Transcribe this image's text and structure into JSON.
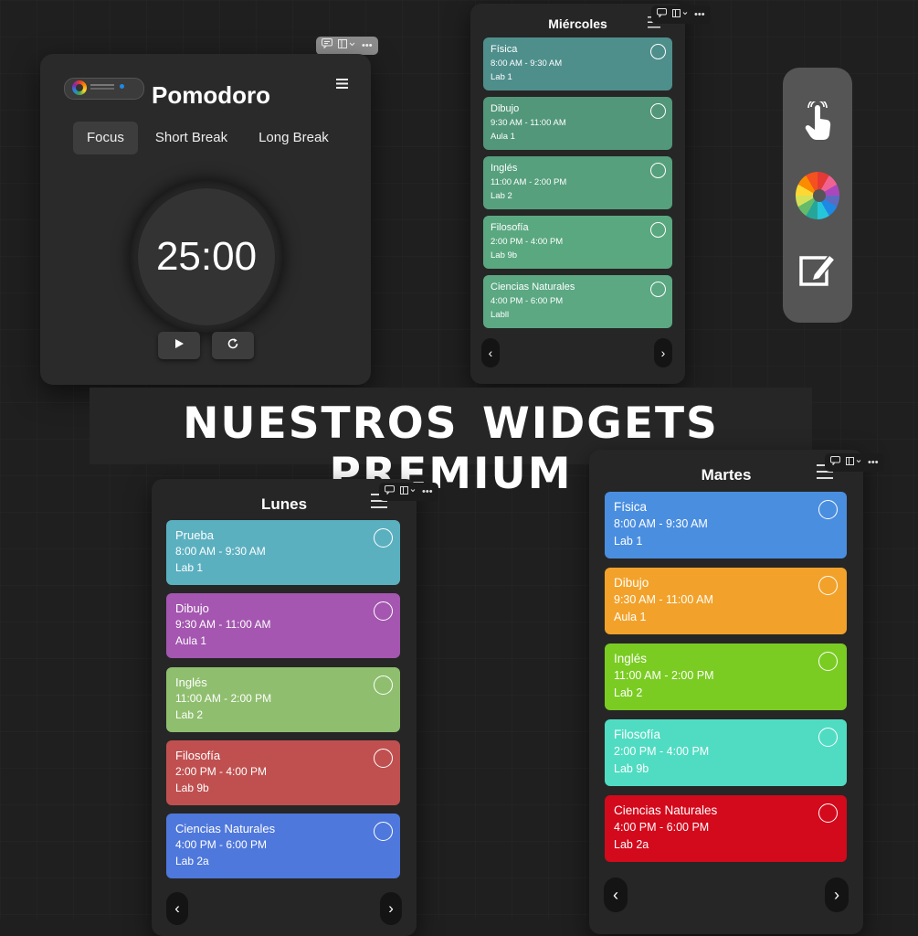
{
  "toolbar_icons": {
    "comment": "comment-icon",
    "layout": "layout-icon",
    "more": "more-icon",
    "menu": "menu-icon"
  },
  "pomodoro": {
    "title": "Pomodoro",
    "tabs": [
      {
        "label": "Focus",
        "active": true
      },
      {
        "label": "Short Break",
        "active": false
      },
      {
        "label": "Long Break",
        "active": false
      }
    ],
    "timer": "25:00",
    "play_icon": "play-icon",
    "reset_icon": "reset-icon"
  },
  "side_bar": {
    "icons": [
      "touch-icon",
      "color-wheel-icon",
      "edit-icon"
    ],
    "bg": "#555555"
  },
  "banner": {
    "text": "NUESTROS WIDGETS PREMIUM"
  },
  "schedules": {
    "miercoles": {
      "title": "Miércoles",
      "classes": [
        {
          "name": "Física",
          "time": "8:00 AM - 9:30 AM",
          "room": "Lab 1",
          "color": "#4e8f8c"
        },
        {
          "name": "Dibujo",
          "time": "9:30 AM - 11:00 AM",
          "room": "Aula 1",
          "color": "#52977a"
        },
        {
          "name": "Inglés",
          "time": "11:00 AM - 2:00 PM",
          "room": "Lab 2",
          "color": "#56a07d"
        },
        {
          "name": "Filosofía",
          "time": "2:00 PM - 4:00 PM",
          "room": "Lab 9b",
          "color": "#5aa880"
        },
        {
          "name": "Ciencias Naturales",
          "time": "4:00 PM - 6:00 PM",
          "room": "Labll",
          "color": "#5ba883"
        }
      ],
      "prev": "‹",
      "next": "›"
    },
    "lunes": {
      "title": "Lunes",
      "classes": [
        {
          "name": "Prueba",
          "time": "8:00 AM - 9:30 AM",
          "room": "Lab 1",
          "color": "#5bb0c0"
        },
        {
          "name": "Dibujo",
          "time": "9:30 AM - 11:00 AM",
          "room": "Aula 1",
          "color": "#a456b0"
        },
        {
          "name": "Inglés",
          "time": "11:00 AM - 2:00 PM",
          "room": "Lab 2",
          "color": "#8fbf6e"
        },
        {
          "name": "Filosofía",
          "time": "2:00 PM - 4:00 PM",
          "room": "Lab 9b",
          "color": "#c05050"
        },
        {
          "name": "Ciencias Naturales",
          "time": "4:00 PM - 6:00 PM",
          "room": "Lab 2a",
          "color": "#4f78dc"
        }
      ],
      "prev": "‹",
      "next": "›"
    },
    "martes": {
      "title": "Martes",
      "classes": [
        {
          "name": "Física",
          "time": "8:00 AM - 9:30 AM",
          "room": "Lab 1",
          "color": "#4a8ee0"
        },
        {
          "name": "Dibujo",
          "time": "9:30 AM - 11:00 AM",
          "room": "Aula 1",
          "color": "#f2a22a"
        },
        {
          "name": "Inglés",
          "time": "11:00 AM - 2:00 PM",
          "room": "Lab 2",
          "color": "#7acc22"
        },
        {
          "name": "Filosofía",
          "time": "2:00 PM - 4:00 PM",
          "room": "Lab 9b",
          "color": "#50dcc2"
        },
        {
          "name": "Ciencias Naturales",
          "time": "4:00 PM - 6:00 PM",
          "room": "Lab 2a",
          "color": "#d3091c"
        }
      ],
      "prev": "‹",
      "next": "›"
    }
  }
}
